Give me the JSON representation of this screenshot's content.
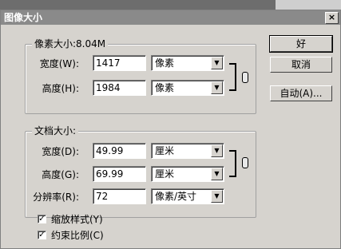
{
  "window": {
    "title": "图像大小",
    "close_glyph": "×"
  },
  "pixel_dimensions": {
    "title": "像素大小:8.04M",
    "width": {
      "label": "宽度(W):",
      "value": "1417",
      "unit": "像素"
    },
    "height": {
      "label": "高度(H):",
      "value": "1984",
      "unit": "像素"
    }
  },
  "document_size": {
    "title": "文档大小:",
    "width": {
      "label": "宽度(D):",
      "value": "49.99",
      "unit": "厘米"
    },
    "height": {
      "label": "高度(G):",
      "value": "69.99",
      "unit": "厘米"
    },
    "resolution": {
      "label": "分辨率(R):",
      "value": "72",
      "unit": "像素/英寸"
    }
  },
  "options": {
    "scale_styles": {
      "label": "缩放样式(Y)",
      "checked": true
    },
    "constrain_proportions": {
      "label": "约束比例(C)",
      "checked": true
    }
  },
  "buttons": {
    "ok": "好",
    "cancel": "取消",
    "auto": "自动(A)..."
  },
  "icons": {
    "dropdown": "▼",
    "check": "✓",
    "link": "chain-link-icon"
  }
}
